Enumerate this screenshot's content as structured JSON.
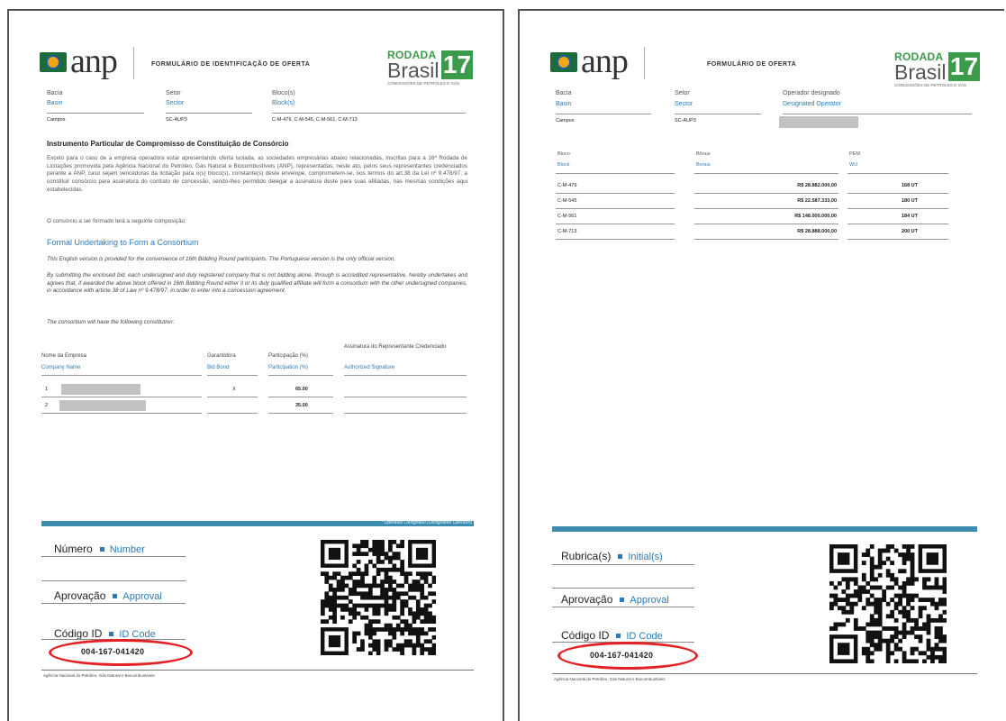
{
  "doc1": {
    "form_title": "FORMULÁRIO DE IDENTIFICAÇÃO DE OFERTA",
    "logo_text": "anp",
    "rodada": {
      "line1": "RODADA",
      "line2": "Brasil",
      "number": "17",
      "sub": "CONCESSÕES DE PETRÓLEO E GÁS"
    },
    "fields": {
      "bacia_pt": "Bacia",
      "bacia_en": "Basin",
      "bacia_value": "Campos",
      "setor_pt": "Setor",
      "setor_en": "Sector",
      "setor_value": "SC-AUP3",
      "bloco_pt": "Bloco(s)",
      "bloco_en": "Block(s)",
      "bloco_value": "C-M-479, C-M-545, C-M-561, C-M-713"
    },
    "section_pt_title": "Instrumento Particular de Compromisso de Constituição de Consórcio",
    "section_pt_text": "Exceto para o caso de a empresa operadora estar apresentando oferta isolada, as sociedades empresárias abaixo relacionadas, inscritas para a 16ª Rodada de Licitações promovida pela Agência Nacional do Petróleo, Gás Natural e Biocombustíveis (ANP), representadas, neste ato, pelos seus representantes credenciados perante a ANP, caso sejam vencedoras da licitação para o(s) bloco(s), constante(s) deste envelope, comprometem-se, nos termos do art.38 da Lei nº 9.478/97, a constituir consórcio para assinatura do contrato de concessão, sendo-lhes permitido delegar a assinatura deste para suas afiliadas, nas mesmas condições aqui estabelecidas.",
    "section_pt_last": "O consórcio a ser formado terá a seguinte composição:",
    "section_en_title": "Formal Undertaking to Form a Consortium",
    "section_en_text": "This English version is provided for the convenience of 16th Bidding Round participants. The Portuguese version is the only official version.",
    "section_en_text2": "By submitting the enclosed bid, each undersigned and duly registered company that is not bidding alone, through is accredited representative, hereby undertakes and agrees that, if awarded the above block offered in 16th Bidding Round either it or its duly qualified affiliate will form a consortium with the other undersigned companies, in accordance with article 38 of Law nº 9.478/97, in order to enter into a concession agreement.",
    "section_en_text3": "The consortium will have the following constitution:",
    "table_headers": {
      "empresa_pt": "Nome da Empresa",
      "empresa_en": "Company Name",
      "garant_pt": "Garantidora",
      "garant_en": "Bid Bond",
      "part_pt": "Participação (%)",
      "part_en": "Participation (%)",
      "sig_pt": "Assinatura do Representante Credenciado",
      "sig_en": "Authorized Signature"
    },
    "rows": [
      {
        "n": "1",
        "garant": "X",
        "part": "65.00"
      },
      {
        "n": "2",
        "garant": "",
        "part": "35.00"
      }
    ],
    "band_label": "* Operador Designado (Designated Operator)",
    "numero_pt": "Número",
    "numero_en": "Number",
    "aprov_pt": "Aprovação",
    "aprov_en": "Approval",
    "codigo_pt": "Código ID",
    "codigo_en": "ID Code",
    "code_value": "004-167-041420",
    "footer": "Agência Nacional do Petróleo, Gás Natural e Biocombustíveis"
  },
  "doc2": {
    "form_title": "FORMULÁRIO DE OFERTA",
    "logo_text": "anp",
    "rodada": {
      "line1": "RODADA",
      "line2": "Brasil",
      "number": "17",
      "sub": "CONCESSÕES DE PETRÓLEO E GÁS"
    },
    "fields": {
      "bacia_pt": "Bacia",
      "bacia_en": "Basin",
      "bacia_value": "Campos",
      "setor_pt": "Setor",
      "setor_en": "Sector",
      "setor_value": "SC-AUP3",
      "oper_pt": "Operador designado",
      "oper_en": "Designated Operator"
    },
    "table_headers": {
      "bloco_pt": "Bloco",
      "bloco_en": "Block",
      "bonus_pt": "Bônus",
      "bonus_en": "Bonus",
      "pem_pt": "PEM",
      "pem_en": "WU"
    },
    "rows": [
      {
        "block": "C-M-479",
        "bonus": "R$ 28.882.000,00",
        "pem": "168 UT"
      },
      {
        "block": "C-M-545",
        "bonus": "R$ 22.587.333,00",
        "pem": "180 UT"
      },
      {
        "block": "C-M-561",
        "bonus": "R$ 148.000.000,00",
        "pem": "184 UT"
      },
      {
        "block": "C-M-713",
        "bonus": "R$ 28.888.000,00",
        "pem": "200 UT"
      }
    ],
    "rubrica_pt": "Rubrica(s)",
    "rubrica_en": "Initial(s)",
    "aprov_pt": "Aprovação",
    "aprov_en": "Approval",
    "codigo_pt": "Código ID",
    "codigo_en": "ID Code",
    "code_value": "004-167-041420",
    "footer": "Agência Nacional do Petróleo, Gás Natural e Biocombustíveis"
  },
  "colors": {
    "accent_blue": "#2c7bb8",
    "band": "#3c8cb0",
    "brand_green": "#3b9b4a",
    "highlight_red": "#e32227"
  }
}
